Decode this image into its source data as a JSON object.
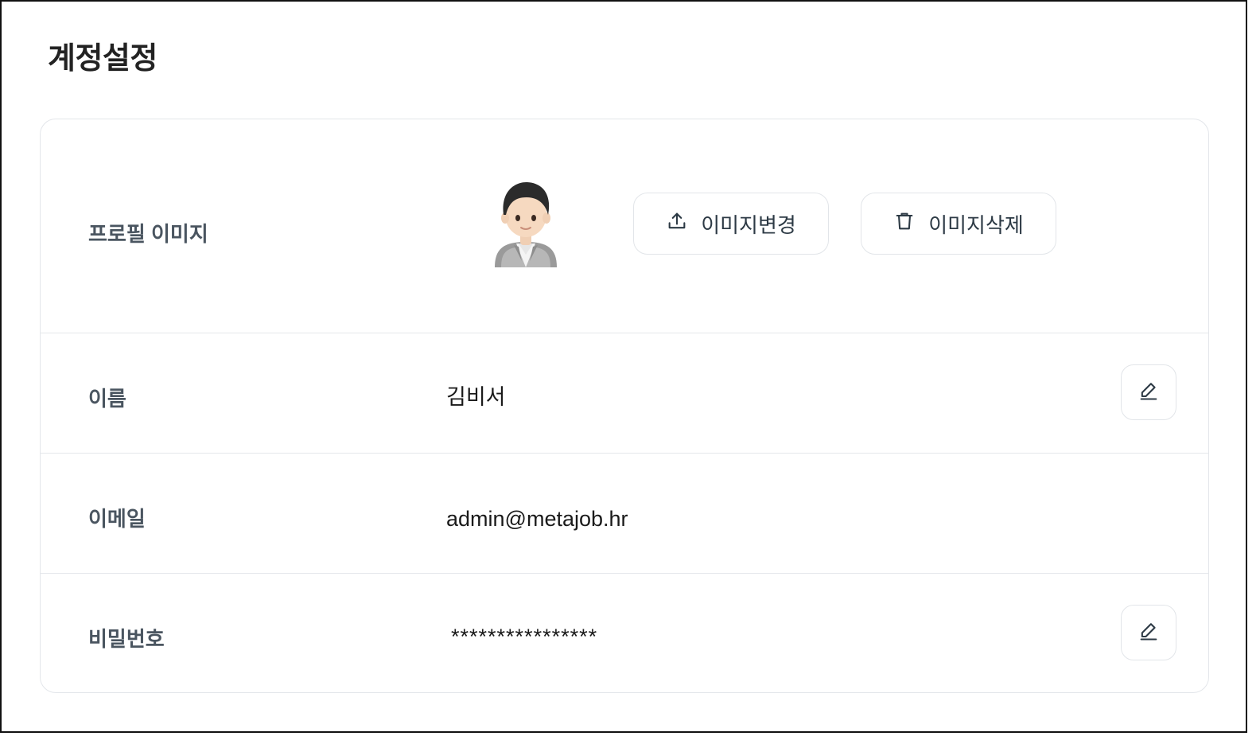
{
  "page": {
    "title": "계정설정"
  },
  "profile_image": {
    "label": "프로필 이미지",
    "avatar_icon": "person-avatar-icon",
    "change_button": {
      "label": "이미지변경",
      "icon": "upload-icon"
    },
    "delete_button": {
      "label": "이미지삭제",
      "icon": "trash-icon"
    }
  },
  "name": {
    "label": "이름",
    "value": "김비서",
    "edit_icon": "pencil-icon"
  },
  "email": {
    "label": "이메일",
    "value": "admin@metajob.hr"
  },
  "password": {
    "label": "비밀번호",
    "value": "****************",
    "edit_icon": "pencil-icon"
  },
  "colors": {
    "border": "#e3e6ea",
    "label_text": "#4a5560",
    "value_text": "#1a1a1a"
  }
}
